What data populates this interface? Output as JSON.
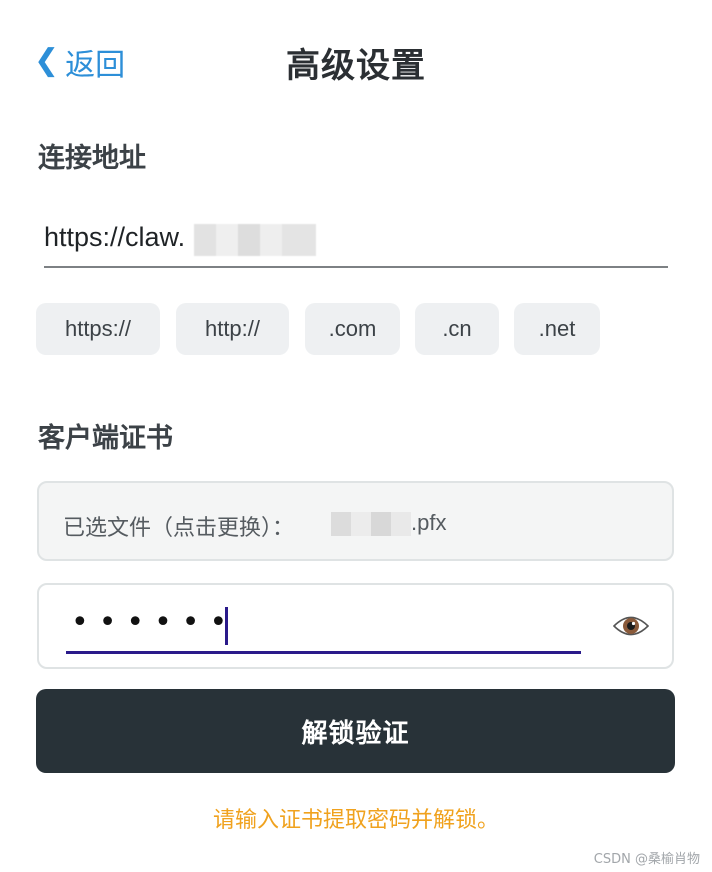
{
  "header": {
    "back_label": "返回",
    "title": "高级设置"
  },
  "connection": {
    "section_label": "连接地址",
    "url_value": "https://claw."
  },
  "chips": [
    {
      "label": "https://"
    },
    {
      "label": "http://"
    },
    {
      "label": ".com"
    },
    {
      "label": ".cn"
    },
    {
      "label": ".net"
    }
  ],
  "certificate": {
    "section_label": "客户端证书",
    "file_label": "已选文件（点击更换）：",
    "file_ext": ".pfx",
    "password_mask": "••••••"
  },
  "actions": {
    "unlock_label": "解锁验证",
    "hint": "请输入证书提取密码并解锁。"
  },
  "watermark": "CSDN @桑榆肖物",
  "colors": {
    "accent": "#2d8fd8",
    "button_bg": "#283238",
    "hint": "#f0a21e",
    "focus": "#2a1a8a"
  },
  "icons": {
    "back": "chevron-left-icon",
    "eye": "eye-icon"
  }
}
